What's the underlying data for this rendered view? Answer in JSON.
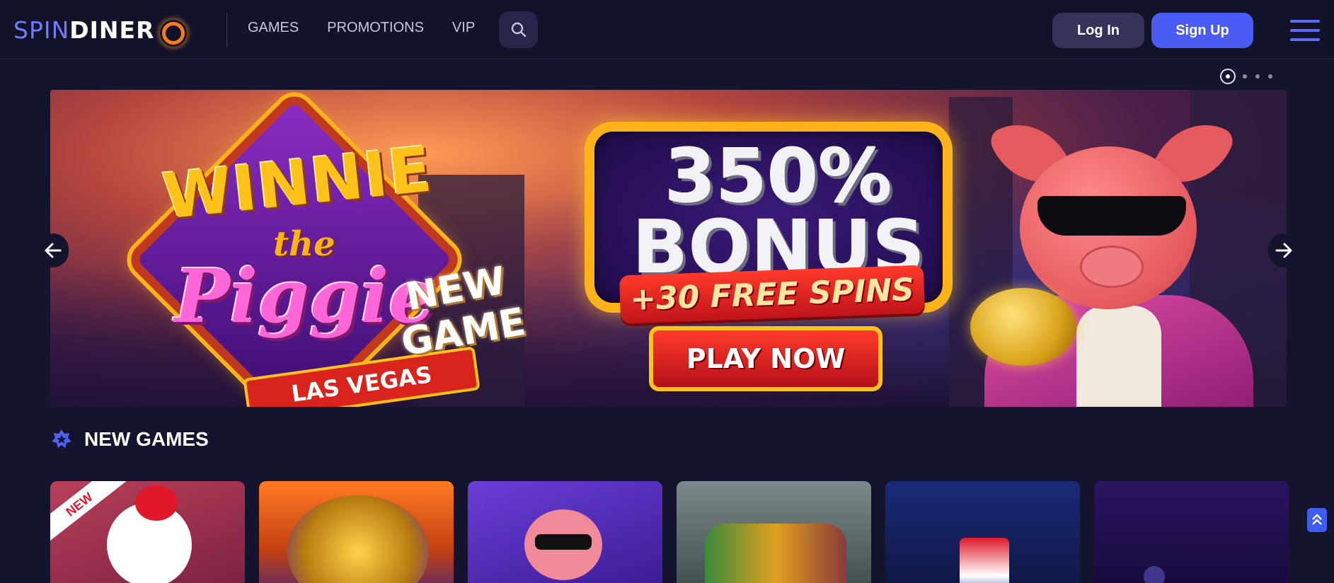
{
  "header": {
    "logo_spin": "SPIN",
    "logo_dinero": "DINER",
    "nav": [
      "GAMES",
      "PROMOTIONS",
      "VIP"
    ],
    "login_label": "Log In",
    "signup_label": "Sign Up"
  },
  "carousel": {
    "slide_count": 4,
    "active_slide": 1
  },
  "banner": {
    "game_title_line1": "WINNIE",
    "game_title_line2": "the",
    "game_title_line3": "Piggie",
    "game_subtitle": "LAS VEGAS",
    "tag_line1": "NEW",
    "tag_line2": "GAME",
    "bonus_percent": "350%",
    "bonus_word": "BONUS",
    "free_spins": "+30 FREE SPINS",
    "cta_label": "PLAY NOW"
  },
  "section": {
    "title": "NEW GAMES",
    "new_badge": "NEW"
  },
  "colors": {
    "background": "#14142e",
    "accent": "#4a5cf3",
    "header": "#121229"
  }
}
